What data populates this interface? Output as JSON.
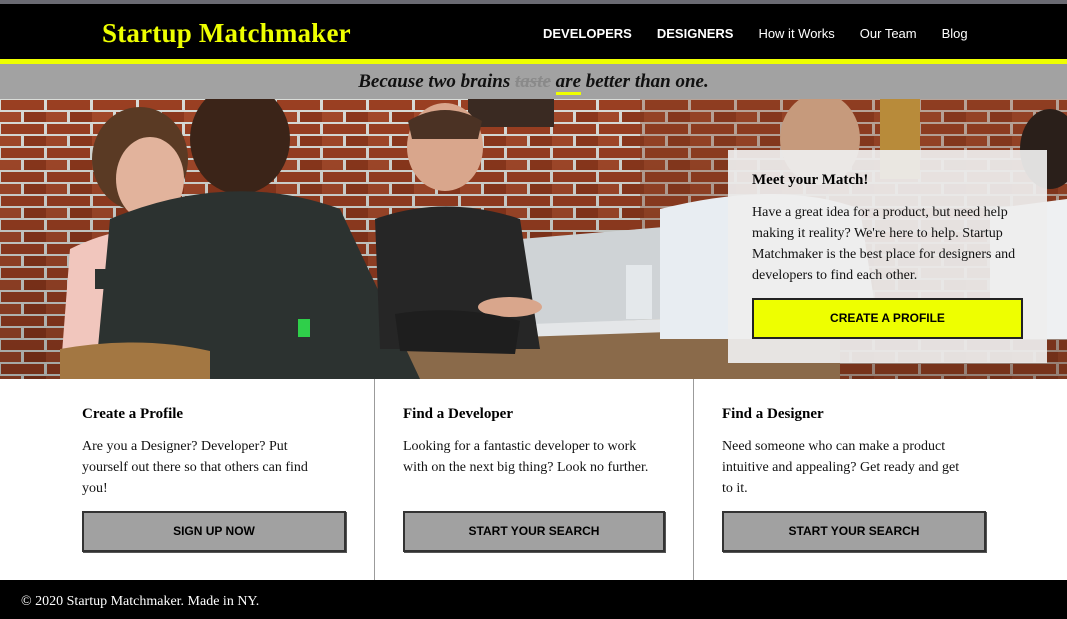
{
  "header": {
    "brand": "Startup Matchmaker",
    "nav": [
      {
        "label": "DEVELOPERS"
      },
      {
        "label": "DESIGNERS"
      },
      {
        "label": "How it Works"
      },
      {
        "label": "Our Team"
      },
      {
        "label": "Blog"
      }
    ],
    "accent_color": "#eeff00"
  },
  "tagline": {
    "part1": "Because two brains ",
    "struck": "taste",
    "space": " ",
    "underlined": "are",
    "part2": " better than one."
  },
  "hero": {
    "card_title": "Meet your Match!",
    "card_body": "Have a great idea for a product, but need help making it reality? We're here to help. Startup Matchmaker is the best place for designers and developers to find each other.",
    "cta": "CREATE A PROFILE"
  },
  "features": [
    {
      "title": "Create a Profile",
      "body": "Are you a Designer? Developer? Put yourself out there so that others can find you!",
      "button": "SIGN UP NOW"
    },
    {
      "title": "Find a Developer",
      "body": "Looking for a fantastic developer to work with on the next big thing? Look no further.",
      "button": "START YOUR SEARCH"
    },
    {
      "title": "Find a Designer",
      "body": "Need someone who can make a product intuitive and appealing? Get ready and get to it.",
      "button": "START YOUR SEARCH"
    }
  ],
  "footer": {
    "text": "© 2020 Startup Matchmaker. Made in NY."
  }
}
